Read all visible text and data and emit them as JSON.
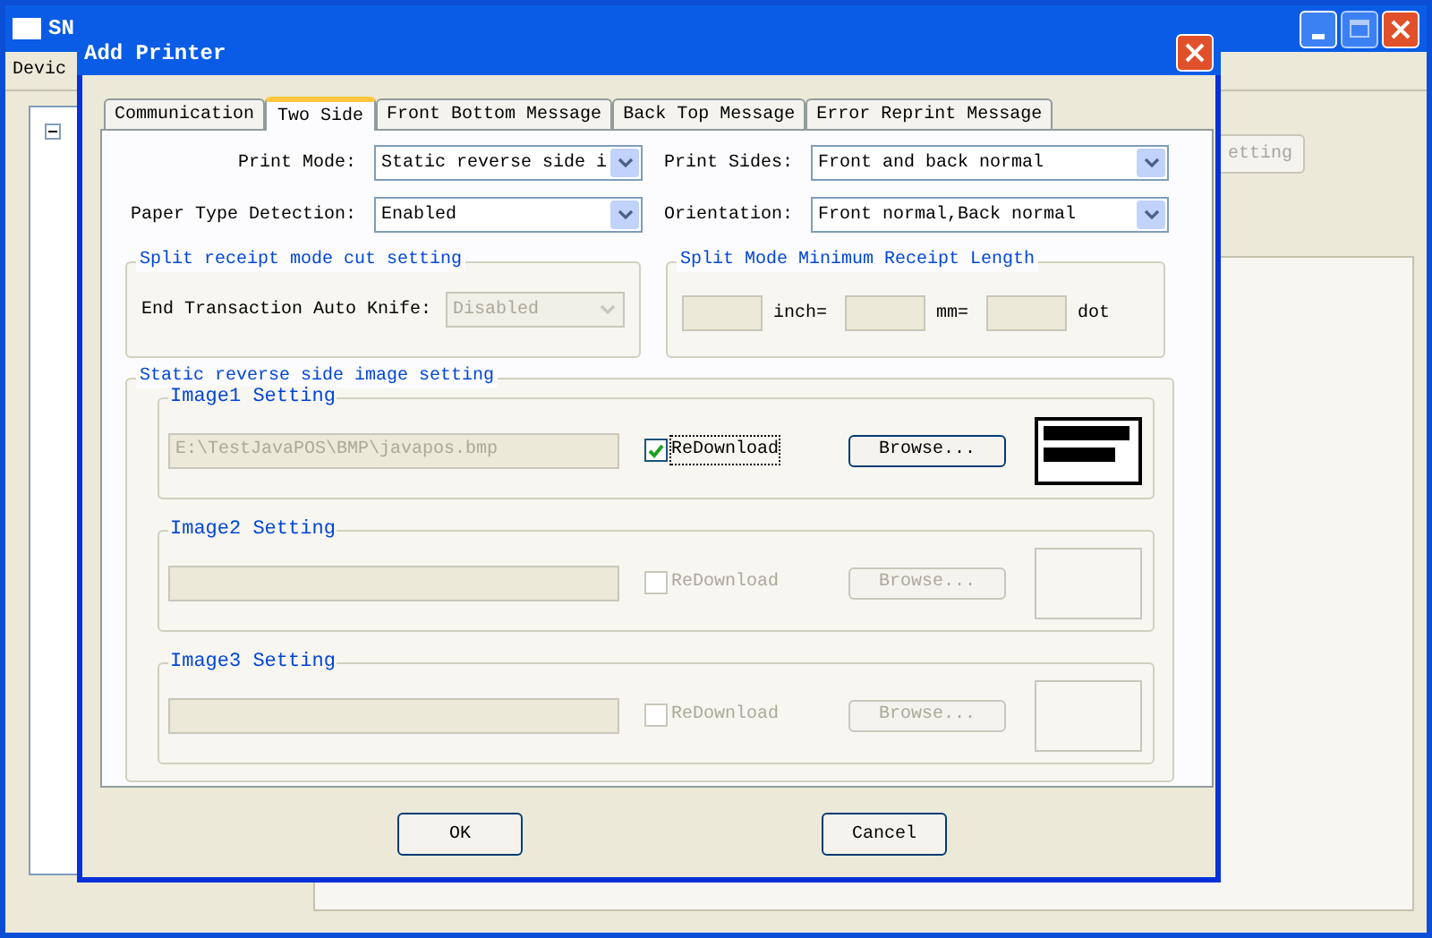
{
  "main_window": {
    "title": "SN",
    "menu": [
      "Devic"
    ],
    "buttons": [
      "etting"
    ]
  },
  "dialog": {
    "title": "Add Printer",
    "tabs": [
      {
        "label": "Communication",
        "selected": false
      },
      {
        "label": "Two Side",
        "selected": true
      },
      {
        "label": "Front Bottom Message",
        "selected": false
      },
      {
        "label": "Back Top Message",
        "selected": false
      },
      {
        "label": "Error Reprint Message",
        "selected": false
      }
    ],
    "fields": [
      {
        "label": "Print Mode:",
        "value": "Static reverse side i"
      },
      {
        "label": "Print Sides:",
        "value": "Front and back normal"
      },
      {
        "label": "Paper Type Detection:",
        "value": "Enabled"
      },
      {
        "label": "Orientation:",
        "value": "Front normal,Back normal"
      }
    ],
    "cut_setting": {
      "title": "Split receipt mode cut setting",
      "label": "End Transaction Auto Knife:",
      "value": "Disabled",
      "disabled": true
    },
    "min_length": {
      "title": "Split Mode Minimum Receipt Length",
      "units": [
        "inch=",
        "mm=",
        "dot"
      ]
    },
    "image_setting": {
      "title": "Static reverse side image setting",
      "images": [
        {
          "title": "Image1 Setting",
          "path": "E:\\TestJavaPOS\\BMP\\javapos.bmp",
          "redownload": "ReDownload",
          "checked": true,
          "enabled": true,
          "browse": "Browse...",
          "preview": true
        },
        {
          "title": "Image2 Setting",
          "redownload": "ReDownload",
          "checked": false,
          "enabled": false,
          "browse": "Browse...",
          "preview": false
        },
        {
          "title": "Image3 Setting",
          "redownload": "ReDownload",
          "checked": false,
          "enabled": false,
          "browse": "Browse...",
          "preview": false
        }
      ]
    },
    "buttons": [
      "OK",
      "Cancel"
    ]
  }
}
